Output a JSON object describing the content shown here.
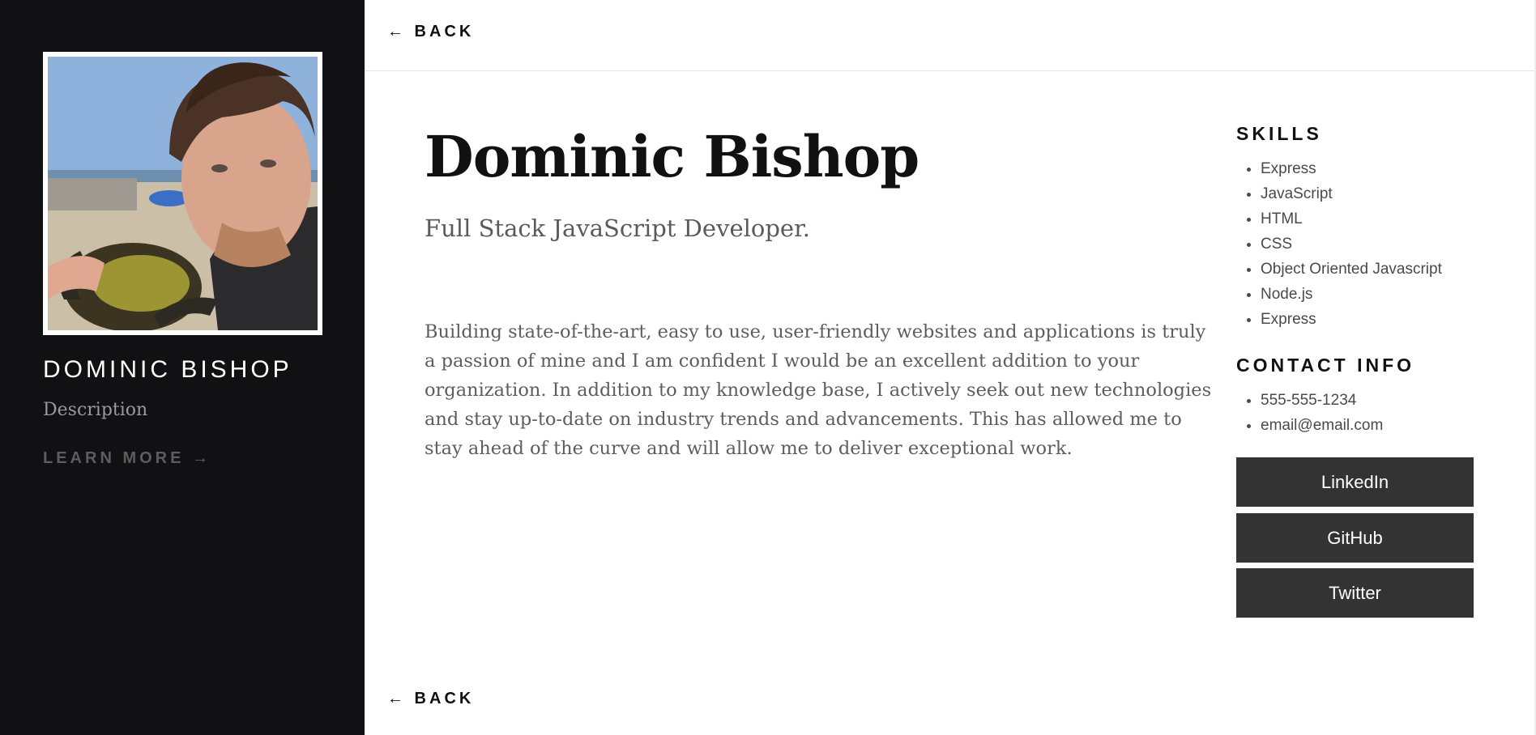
{
  "nav": {
    "back_label": "← BACK"
  },
  "sidebar": {
    "name": "DOMINIC BISHOP",
    "description": "Description",
    "learn_more": "LEARN MORE →"
  },
  "main": {
    "title": "Dominic Bishop",
    "subtitle": "Full Stack JavaScript Developer.",
    "bio": "Building state-of-the-art, easy to use, user-friendly websites and applications is truly a passion of mine and I am confident I would be an excellent addition to your organization. In addition to my knowledge base, I actively seek out new technologies and stay up-to-date on industry trends and advancements. This has allowed me to stay ahead of the curve and will allow me to deliver exceptional work."
  },
  "skills": {
    "heading": "SKILLS",
    "items": [
      "Express",
      "JavaScript",
      "HTML",
      "CSS",
      "Object Oriented Javascript",
      "Node.js",
      "Express"
    ]
  },
  "contact": {
    "heading": "CONTACT INFO",
    "items": [
      "555-555-1234",
      "email@email.com"
    ]
  },
  "social": {
    "linkedin": "LinkedIn",
    "github": "GitHub",
    "twitter": "Twitter"
  },
  "colors": {
    "sidebar_bg": "#111113",
    "button_bg": "#333333",
    "text_dark": "#111111",
    "text_muted": "#5d5d5d"
  },
  "icons": {
    "profile_photo": "profile-photo"
  }
}
